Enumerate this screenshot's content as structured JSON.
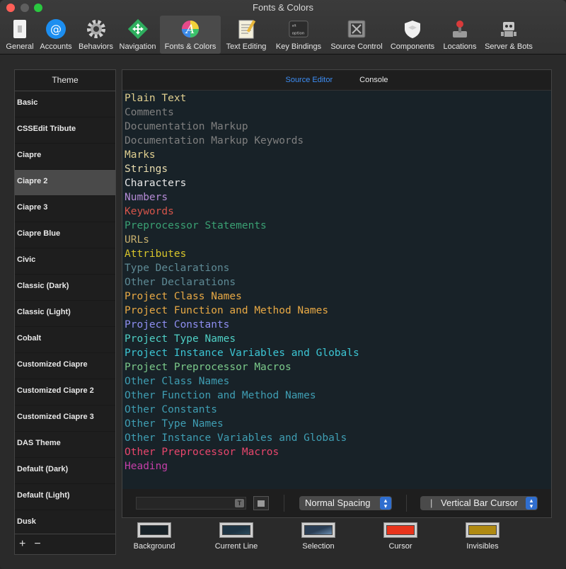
{
  "window": {
    "title": "Fonts & Colors"
  },
  "toolbar": [
    {
      "label": "General",
      "icon": "switch-icon"
    },
    {
      "label": "Accounts",
      "icon": "at-sign-icon"
    },
    {
      "label": "Behaviors",
      "icon": "gear-icon"
    },
    {
      "label": "Navigation",
      "icon": "move-arrows-icon"
    },
    {
      "label": "Fonts & Colors",
      "icon": "font-color-icon",
      "active": true
    },
    {
      "label": "Text Editing",
      "icon": "document-pencil-icon"
    },
    {
      "label": "Key Bindings",
      "icon": "option-key-icon"
    },
    {
      "label": "Source Control",
      "icon": "source-control-icon"
    },
    {
      "label": "Components",
      "icon": "shield-box-icon"
    },
    {
      "label": "Locations",
      "icon": "joystick-icon"
    },
    {
      "label": "Server & Bots",
      "icon": "robot-icon"
    }
  ],
  "sidebar": {
    "header": "Theme",
    "items": [
      "Basic",
      "CSSEdit Tribute",
      "Ciapre",
      "Ciapre 2",
      "Ciapre 3",
      "Ciapre Blue",
      "Civic",
      "Classic (Dark)",
      "Classic (Light)",
      "Cobalt",
      "Customized Ciapre",
      "Customized Ciapre 2",
      "Customized Ciapre 3",
      "DAS Theme",
      "Default (Dark)",
      "Default (Light)",
      "Dusk"
    ],
    "selected": "Ciapre 2",
    "add_label": "+",
    "remove_label": "−"
  },
  "tabs": {
    "source_editor": "Source Editor",
    "console": "Console"
  },
  "editor": {
    "background": "#182228",
    "lines": [
      {
        "text": "Plain Text",
        "color": "#e0cf8f"
      },
      {
        "text": "Comments",
        "color": "#7f7f7f"
      },
      {
        "text": "Documentation Markup",
        "color": "#7f7f7f"
      },
      {
        "text": "Documentation Markup Keywords",
        "color": "#7f7f7f"
      },
      {
        "text": "Marks",
        "color": "#e0cf8f"
      },
      {
        "text": "Strings",
        "color": "#e8dcae"
      },
      {
        "text": "Characters",
        "color": "#e8e8e8"
      },
      {
        "text": "Numbers",
        "color": "#b58bd6"
      },
      {
        "text": "Keywords",
        "color": "#d5554a"
      },
      {
        "text": "Preprocessor Statements",
        "color": "#3aa073"
      },
      {
        "text": "URLs",
        "color": "#c8b06e"
      },
      {
        "text": "Attributes",
        "color": "#d7c42b"
      },
      {
        "text": "Type Declarations",
        "color": "#5e8a95"
      },
      {
        "text": "Other Declarations",
        "color": "#5e8a95"
      },
      {
        "text": "Project Class Names",
        "color": "#e8a945"
      },
      {
        "text": "Project Function and Method Names",
        "color": "#e8a945"
      },
      {
        "text": "Project Constants",
        "color": "#8e8ef0"
      },
      {
        "text": "Project Type Names",
        "color": "#4fd0c6"
      },
      {
        "text": "Project Instance Variables and Globals",
        "color": "#3cc6d4"
      },
      {
        "text": "Project Preprocessor Macros",
        "color": "#7bc98a"
      },
      {
        "text": "Other Class Names",
        "color": "#3f9eb3"
      },
      {
        "text": "Other Function and Method Names",
        "color": "#3f9eb3"
      },
      {
        "text": "Other Constants",
        "color": "#3f9eb3"
      },
      {
        "text": "Other Type Names",
        "color": "#3f9eb3"
      },
      {
        "text": "Other Instance Variables and Globals",
        "color": "#3f9eb3"
      },
      {
        "text": "Other Preprocessor Macros",
        "color": "#e8466c"
      },
      {
        "text": "Heading",
        "color": "#c43fa8"
      }
    ]
  },
  "bottom": {
    "font_icon": "font-picker-icon",
    "spacing": "Normal Spacing",
    "cursor": "Vertical Bar Cursor"
  },
  "swatches": [
    {
      "label": "Background",
      "color": "#182228"
    },
    {
      "label": "Current Line",
      "color": "#1d3444"
    },
    {
      "label": "Selection",
      "color": "#3c5572"
    },
    {
      "label": "Cursor",
      "color": "#e8341c"
    },
    {
      "label": "Invisibles",
      "color": "#b08a12"
    }
  ]
}
